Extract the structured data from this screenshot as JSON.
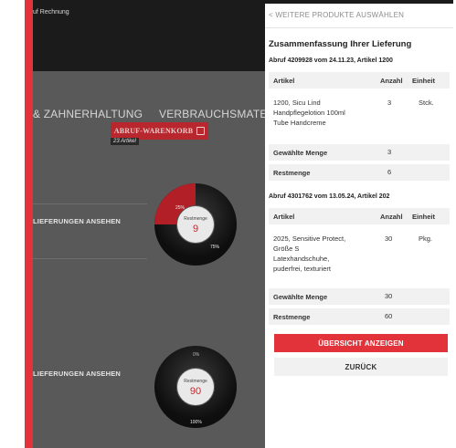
{
  "topbar": {
    "text": "uf Rechnung"
  },
  "nav": {
    "item1": "& ZAHNERHALTUNG",
    "item2": "VERBRAUCHSMATERIAL"
  },
  "cart": {
    "label": "ABRUF-WARENKORB",
    "badge": "23 Artikel"
  },
  "deliveries": [
    {
      "link": "LIEFERUNGEN ANSEHEN",
      "label": "Restmenge",
      "value": "9",
      "pct_top": "25%",
      "pct_bottom": "75%",
      "fill_fraction": 0.25
    },
    {
      "link": "LIEFERUNGEN ANSEHEN",
      "label": "Restmenge",
      "value": "90",
      "pct_top": "0%",
      "pct_bottom": "100%",
      "fill_fraction": 0.0
    }
  ],
  "panel": {
    "back": "WEITERE PRODUKTE AUSWÄHLEN",
    "title": "Zusammenfassung Ihrer Lieferung",
    "orders": [
      {
        "heading": "Abruf 4209928 vom 24.11.23, Artikel 1200",
        "col_article": "Artikel",
        "col_qty": "Anzahl",
        "col_unit": "Einheit",
        "item_lines": [
          "1200, Sicu Lind",
          "Handpflegelotion 100ml",
          "Tube Handcreme"
        ],
        "qty": "3",
        "unit": "Stck.",
        "chosen_label": "Gewählte Menge",
        "chosen_value": "3",
        "rest_label": "Restmenge",
        "rest_value": "6"
      },
      {
        "heading": "Abruf 4301762 vom 13.05.24, Artikel 202",
        "col_article": "Artikel",
        "col_qty": "Anzahl",
        "col_unit": "Einheit",
        "item_lines": [
          "2025, Sensitive Protect,",
          "Größe S",
          "Latexhandschuhe,",
          "puderfrei, texturiert"
        ],
        "qty": "30",
        "unit": "Pkg.",
        "chosen_label": "Gewählte Menge",
        "chosen_value": "30",
        "rest_label": "Restmenge",
        "rest_value": "60"
      }
    ],
    "overview_button": "ÜBERSICHT ANZEIGEN",
    "back_button": "ZURÜCK"
  },
  "colors": {
    "accent": "#e2333a",
    "dark_accent": "#b8272d",
    "panel_bg": "#ffffff",
    "row_bg": "#f1f1f1"
  }
}
